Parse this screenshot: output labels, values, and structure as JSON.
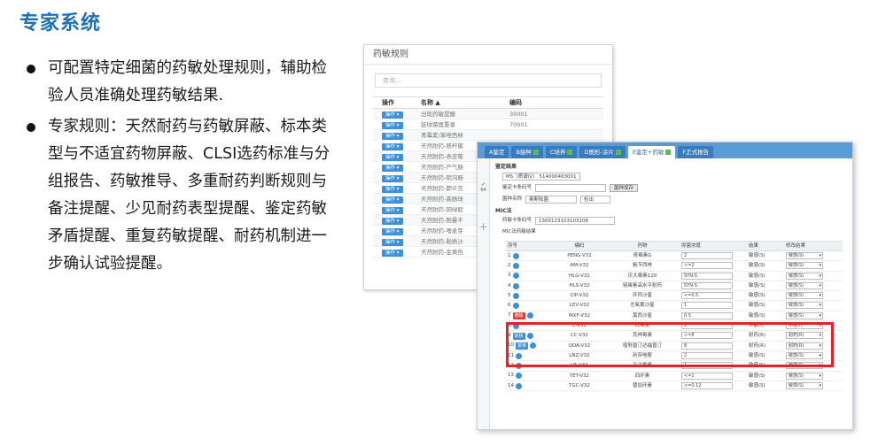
{
  "page": {
    "title": "专家系统",
    "bullets": [
      "可配置特定细菌的药敏处理规则，辅助检验人员准确处理药敏结果.",
      "专家规则：天然耐药与药敏屏蔽、标本类型与不适宜药物屏蔽、CLSI选药标准与分组报告、药敏推导、多重耐药判断规则与备注提醒、少见耐药表型提醒、鉴定药敏矛盾提醒、重复药敏提醒、耐药机制进一步确认试验提醒。"
    ]
  },
  "back_window": {
    "title": "药敏规则",
    "search_placeholder": "查询...",
    "headers": {
      "op": "操作",
      "name": "名称 ▲",
      "code": "编码"
    },
    "op_label": "操作 ▾",
    "rows": [
      {
        "name": "出现药敏提醒",
        "code": "30001"
      },
      {
        "name": "链球菌属重录",
        "code": "70001"
      },
      {
        "name": "青霉素/苯唑西林",
        "code": ""
      },
      {
        "name": "天然耐药-肠杆菌",
        "code": ""
      },
      {
        "name": "天然耐药-表皮葡",
        "code": ""
      },
      {
        "name": "天然耐药-产气肠",
        "code": ""
      },
      {
        "name": "天然耐药-阴沟肠",
        "code": ""
      },
      {
        "name": "天然耐药-肺炎克",
        "code": ""
      },
      {
        "name": "天然耐药-粪肠球",
        "code": ""
      },
      {
        "name": "天然耐药-铜绿假",
        "code": ""
      },
      {
        "name": "天然耐药-鲍曼不",
        "code": ""
      },
      {
        "name": "天然耐药-嗜麦芽",
        "code": ""
      },
      {
        "name": "天然耐药-黏质沙",
        "code": ""
      },
      {
        "name": "天然耐药-金黄色",
        "code": ""
      }
    ]
  },
  "front_window": {
    "tabs": [
      "A鉴定",
      "B接种",
      "C培养",
      "D图形-涂片",
      "E鉴定+药敏",
      "F正式报告"
    ],
    "active_tab_index": 4,
    "section_identify": "鉴定结果",
    "ms_label": "MS（质谱仪）",
    "ms_value": "514000463001",
    "identify_no_label": "鉴定卡条码号",
    "save_label": "菌种保存",
    "species_label": "菌种名称",
    "species_value": "奥斯陆菌",
    "detect_value": "检出",
    "section_mic": "MIC法",
    "sens_no_label": "药敏卡条码号",
    "sens_no_value": "1300123103103108",
    "mic_result_label": "MIC法药敏结果",
    "sidebar_number": "64",
    "table_headers": [
      "序号",
      "编码",
      "药物",
      "抑菌浓度",
      "结果",
      "修改结果"
    ],
    "rows": [
      {
        "no": "1",
        "code": "PENG-V32",
        "drug": "青霉素G",
        "mic": "2",
        "result": "敏感(S)",
        "mod": "敏感(S)",
        "tag": ""
      },
      {
        "no": "2",
        "code": "AM-V32",
        "drug": "氨苄西林",
        "mic": "<=2",
        "result": "敏感(S)",
        "mod": "敏感(S)",
        "tag": ""
      },
      {
        "no": "3",
        "code": "HLG-V32",
        "drug": "庆大霉素120",
        "mic": "SYN-S",
        "result": "敏感(S)",
        "mod": "敏感(S)",
        "tag": ""
      },
      {
        "no": "4",
        "code": "HLS-V32",
        "drug": "链霉素高水平耐药",
        "mic": "SYN-S",
        "result": "敏感(S)",
        "mod": "敏感(S)",
        "tag": ""
      },
      {
        "no": "5",
        "code": "CIP-V32",
        "drug": "环丙沙星",
        "mic": "<=0.5",
        "result": "敏感(S)",
        "mod": "敏感(S)",
        "tag": ""
      },
      {
        "no": "6",
        "code": "LEV-V32",
        "drug": "左氧氟沙星",
        "mic": "1",
        "result": "敏感(S)",
        "mod": "敏感(S)",
        "tag": ""
      },
      {
        "no": "7",
        "code": "MXF-V32",
        "drug": "莫西沙星",
        "mic": "0.5",
        "result": "敏感(S)",
        "mod": "敏感(S)",
        "tag": "删除"
      },
      {
        "no": "8",
        "code": "E-V32",
        "drug": "红霉素",
        "mic": "2",
        "result": "中敏(I)",
        "mod": "中敏(I)",
        "tag": ""
      },
      {
        "no": "9",
        "code": "CC-V32",
        "drug": "克林霉素",
        "mic": ">=8",
        "result": "耐药(R)",
        "mod": "耐药(R)",
        "tag": "复核"
      },
      {
        "no": "10",
        "code": "QDA-V32",
        "drug": "喹努普汀达福普汀",
        "mic": "8",
        "result": "耐药(R)",
        "mod": "耐药(R)",
        "tag": "复核"
      },
      {
        "no": "11",
        "code": "LNZ-V32",
        "drug": "利奈唑胺",
        "mic": "2",
        "result": "敏感(S)",
        "mod": "敏感(S)",
        "tag": ""
      },
      {
        "no": "12",
        "code": "VA-V32",
        "drug": "万古霉素",
        "mic": "1",
        "result": "敏感(S)",
        "mod": "敏感(S)",
        "tag": ""
      },
      {
        "no": "13",
        "code": "TET-V32",
        "drug": "四环素",
        "mic": "<=1",
        "result": "敏感(S)",
        "mod": "敏感(S)",
        "tag": ""
      },
      {
        "no": "14",
        "code": "TGC-V32",
        "drug": "替加环素",
        "mic": "<=0.12",
        "result": "敏感(S)",
        "mod": "敏感(S)",
        "tag": ""
      }
    ]
  },
  "colors": {
    "title": "#1f6fb5",
    "accent": "#3d8fd6",
    "highlight": "#e8202a",
    "delete_tag": "#e53935"
  }
}
